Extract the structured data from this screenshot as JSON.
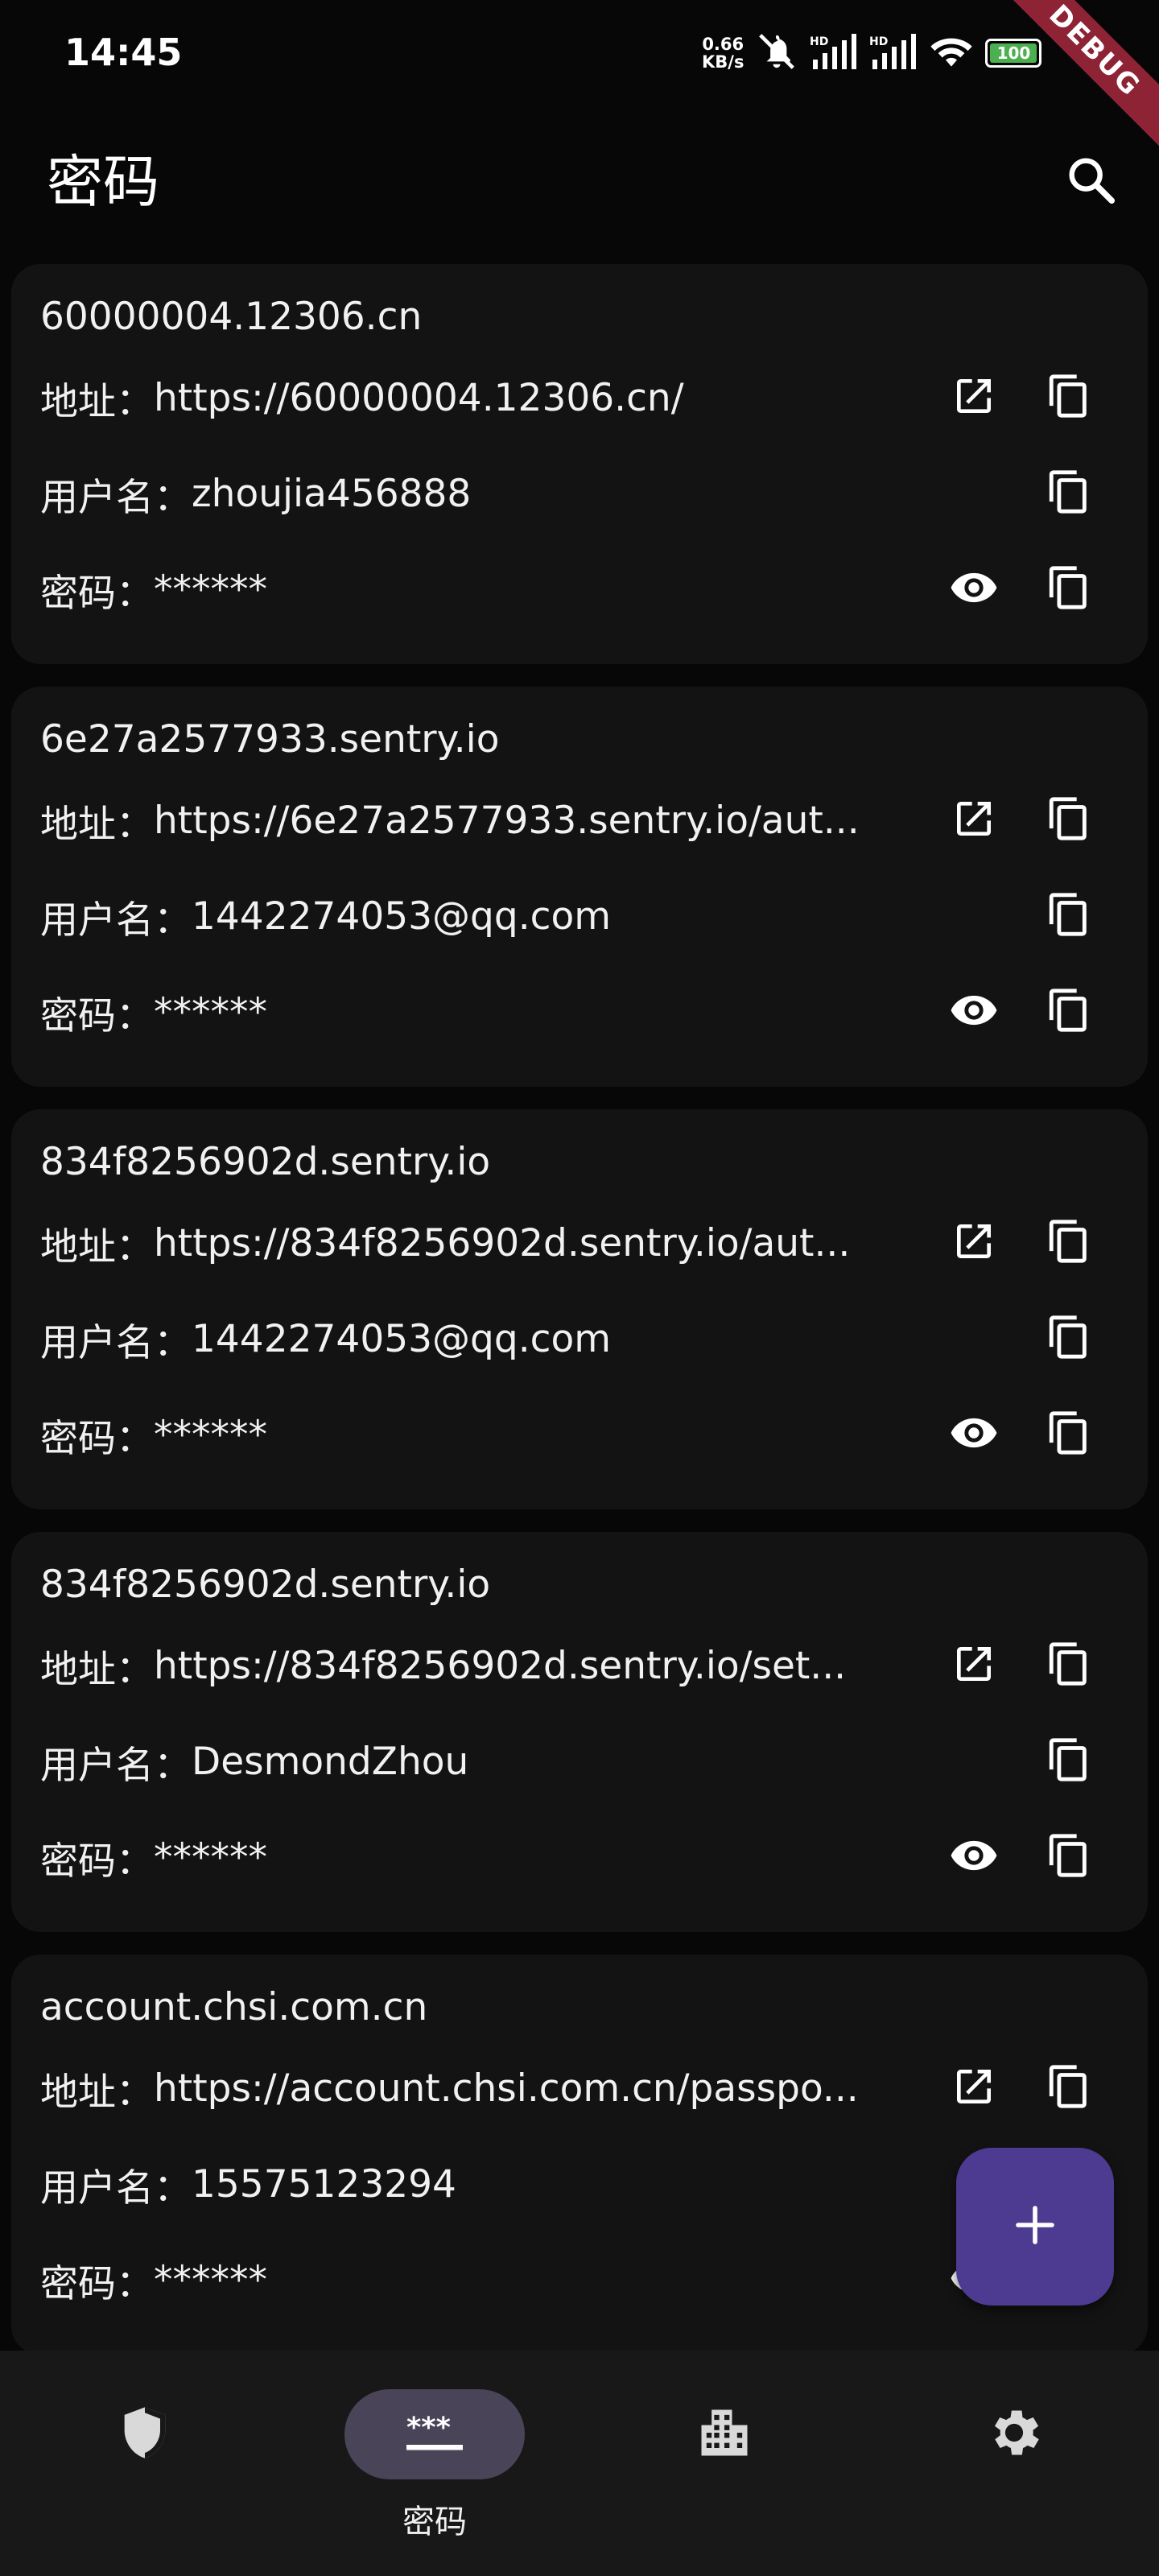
{
  "status_bar": {
    "time": "14:45",
    "net_speed_value": "0.66",
    "net_speed_unit": "KB/s",
    "battery": "100",
    "debug_label": "DEBUG"
  },
  "app_bar": {
    "title": "密码",
    "search_icon": "search-icon"
  },
  "labels": {
    "address": "地址：",
    "username": "用户名：",
    "password": "密码："
  },
  "passwords": [
    {
      "title": "60000004.12306.cn",
      "url": "https://60000004.12306.cn/",
      "username": "zhoujia456888",
      "password": "******"
    },
    {
      "title": "6e27a2577933.sentry.io",
      "url": "https://6e27a2577933.sentry.io/aut...",
      "username": "1442274053@qq.com",
      "password": "******"
    },
    {
      "title": "834f8256902d.sentry.io",
      "url": "https://834f8256902d.sentry.io/aut...",
      "username": "1442274053@qq.com",
      "password": "******"
    },
    {
      "title": "834f8256902d.sentry.io",
      "url": "https://834f8256902d.sentry.io/set...",
      "username": "DesmondZhou",
      "password": "******"
    },
    {
      "title": "account.chsi.com.cn",
      "url": "https://account.chsi.com.cn/passpo...",
      "username": "15575123294",
      "password": "******"
    }
  ],
  "fab": {
    "icon": "add-icon"
  },
  "bottom_nav": {
    "items": [
      {
        "icon": "shield-icon",
        "label": ""
      },
      {
        "icon": "password-icon",
        "label": "密码",
        "active": true
      },
      {
        "icon": "building-icon",
        "label": ""
      },
      {
        "icon": "gear-icon",
        "label": ""
      }
    ]
  },
  "colors": {
    "background": "#070707",
    "card": "#131313",
    "fab": "#4d3a91",
    "nav_active": "#4a4458",
    "debug_banner": "#8d2334"
  }
}
